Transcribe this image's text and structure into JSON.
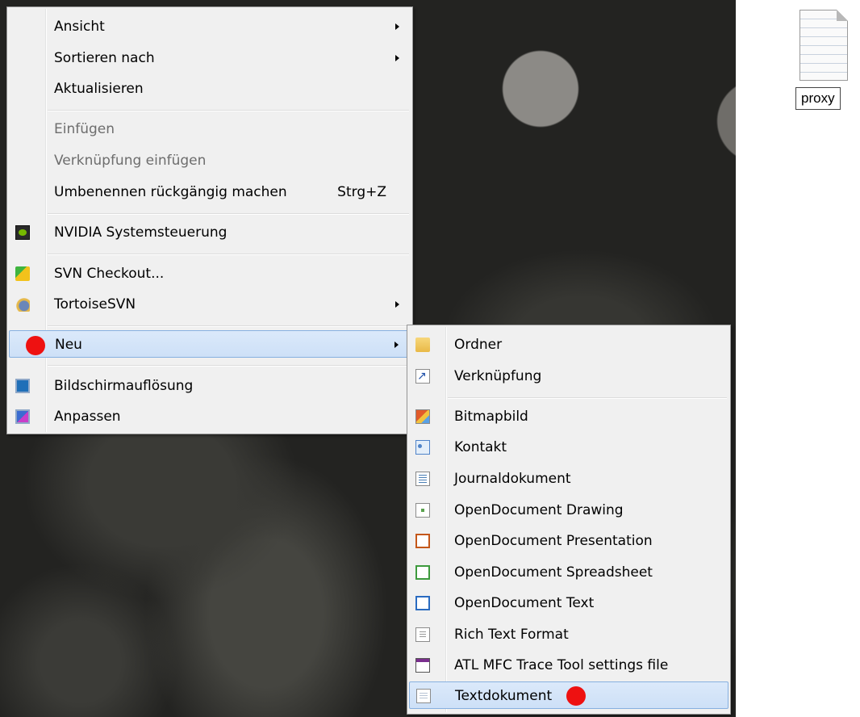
{
  "desktop": {
    "file_icon": {
      "label": "proxy"
    }
  },
  "context_menu": {
    "items": [
      {
        "label": "Ansicht",
        "submenu": true
      },
      {
        "label": "Sortieren nach",
        "submenu": true
      },
      {
        "label": "Aktualisieren"
      },
      {
        "label": "Einfügen",
        "disabled": true
      },
      {
        "label": "Verknüpfung einfügen",
        "disabled": true
      },
      {
        "label": "Umbenennen rückgängig machen",
        "shortcut": "Strg+Z"
      },
      {
        "label": "NVIDIA Systemsteuerung",
        "icon": "nvidia-icon"
      },
      {
        "label": "SVN Checkout...",
        "icon": "svn-checkout-icon"
      },
      {
        "label": "TortoiseSVN",
        "icon": "tortoise-svn-icon",
        "submenu": true
      },
      {
        "label": "Neu",
        "submenu": true,
        "highlighted": true
      },
      {
        "label": "Bildschirmauflösung",
        "icon": "display-settings-icon"
      },
      {
        "label": "Anpassen",
        "icon": "personalize-icon"
      }
    ]
  },
  "new_submenu": {
    "items": [
      {
        "label": "Ordner",
        "icon": "folder-icon"
      },
      {
        "label": "Verknüpfung",
        "icon": "shortcut-icon"
      },
      {
        "label": "Bitmapbild",
        "icon": "bitmap-icon"
      },
      {
        "label": "Kontakt",
        "icon": "contact-icon"
      },
      {
        "label": "Journaldokument",
        "icon": "journal-icon"
      },
      {
        "label": "OpenDocument Drawing",
        "icon": "odg-icon"
      },
      {
        "label": "OpenDocument Presentation",
        "icon": "odp-icon"
      },
      {
        "label": "OpenDocument Spreadsheet",
        "icon": "ods-icon"
      },
      {
        "label": "OpenDocument Text",
        "icon": "odt-icon"
      },
      {
        "label": "Rich Text Format",
        "icon": "rtf-icon"
      },
      {
        "label": "ATL MFC Trace Tool settings file",
        "icon": "atl-trace-icon"
      },
      {
        "label": "Textdokument",
        "icon": "text-document-icon",
        "highlighted": true
      }
    ]
  },
  "annotation_color": "#ee1111",
  "highlight_color": "#cde0f7"
}
